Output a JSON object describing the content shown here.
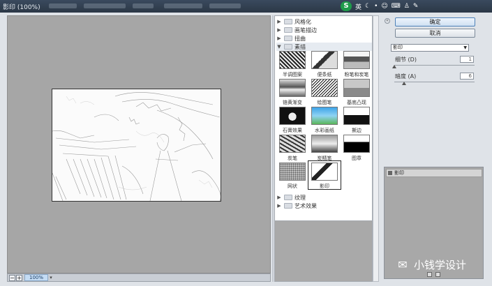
{
  "window": {
    "title": "影印 (100%)"
  },
  "ime": {
    "logo": "S",
    "mode": "英",
    "icons": [
      "moon-icon",
      "dot-icon",
      "smile-icon",
      "keyboard-icon",
      "shirt-icon",
      "wrench-icon"
    ]
  },
  "preview": {
    "zoom": "100%",
    "zoom_out": "−",
    "zoom_in": "+"
  },
  "browser": {
    "categories_top": [
      {
        "label": "风格化",
        "expanded": false
      },
      {
        "label": "画笔描边",
        "expanded": false
      },
      {
        "label": "扭曲",
        "expanded": false
      },
      {
        "label": "素描",
        "expanded": true
      }
    ],
    "filters": [
      {
        "label": "半调图案"
      },
      {
        "label": "便条纸"
      },
      {
        "label": "粉笔和炭笔"
      },
      {
        "label": "铬黄渐变"
      },
      {
        "label": "绘图笔"
      },
      {
        "label": "基底凸现"
      },
      {
        "label": "石膏效果"
      },
      {
        "label": "水彩画纸"
      },
      {
        "label": "撕边"
      },
      {
        "label": "炭笔"
      },
      {
        "label": "炭精笔"
      },
      {
        "label": "图章"
      },
      {
        "label": "网状"
      },
      {
        "label": "影印"
      }
    ],
    "selected_filter": "影印",
    "categories_bottom": [
      {
        "label": "纹理"
      },
      {
        "label": "艺术效果"
      }
    ]
  },
  "options": {
    "ok_label": "确定",
    "cancel_label": "取消",
    "filter_select": "影印",
    "params": [
      {
        "label": "细节 (D)",
        "value": "1",
        "level": 0.0
      },
      {
        "label": "暗度 (A)",
        "value": "6",
        "level": 0.12
      }
    ]
  },
  "layers": {
    "items": [
      {
        "name": "影印"
      }
    ]
  },
  "watermark": {
    "text": "小钱学设计"
  },
  "colors": {
    "accent": "#4f82b8",
    "preview_bg": "#a6a6a6",
    "title_bar": "#2b3746"
  }
}
